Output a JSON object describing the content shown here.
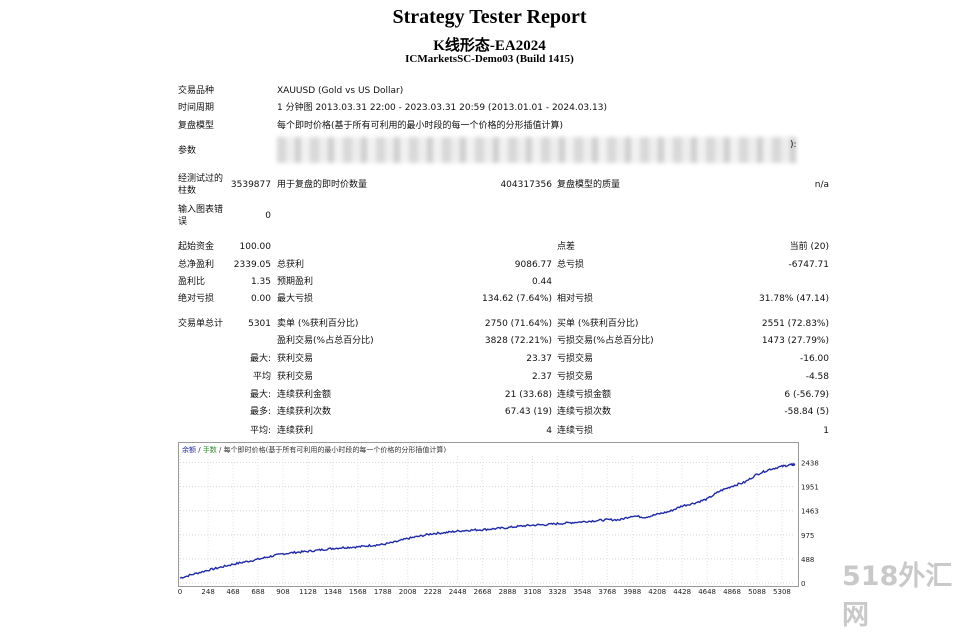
{
  "report": {
    "title": "Strategy Tester Report",
    "ea_name": "K线形态-EA2024",
    "server": "ICMarketsSC-Demo03 (Build 1415)"
  },
  "settings": {
    "symbol_label": "交易品种",
    "symbol_value": "XAUUSD (Gold vs US Dollar)",
    "period_label": "时间周期",
    "period_value": "1 分钟图 2013.03.31 22:00 - 2023.03.31 20:59 (2013.01.01 - 2024.03.13)",
    "model_label": "复盘模型",
    "model_value": "每个即时价格(基于所有可利用的最小时段的每一个价格的分形插值计算)",
    "params_label": "参数",
    "params_tail": "):"
  },
  "quality": {
    "bars_label": "经测试过的柱数",
    "bars_value": "3539877",
    "ticks_label": "用于复盘的即时价数量",
    "ticks_value": "404317356",
    "quality_label": "复盘模型的质量",
    "quality_value": "n/a",
    "errors_label": "输入图表错误",
    "errors_value": "0"
  },
  "stats": {
    "deposit_label": "起始资金",
    "deposit_value": "100.00",
    "spread_label": "点差",
    "spread_value": "当前 (20)",
    "net_label": "总净盈利",
    "net_value": "2339.05",
    "gross_profit_label": "总获利",
    "gross_profit_value": "9086.77",
    "gross_loss_label": "总亏损",
    "gross_loss_value": "-6747.71",
    "pf_label": "盈利比",
    "pf_value": "1.35",
    "payoff_label": "预期盈利",
    "payoff_value": "0.44",
    "abs_dd_label": "绝对亏损",
    "abs_dd_value": "0.00",
    "max_dd_label": "最大亏损",
    "max_dd_value": "134.62 (7.64%)",
    "rel_dd_label": "相对亏损",
    "rel_dd_value": "31.78% (47.14)",
    "trades_label": "交易单总计",
    "trades_value": "5301",
    "short_label": "卖单 (%获利百分比)",
    "short_value": "2750 (71.64%)",
    "long_label": "买单 (%获利百分比)",
    "long_value": "2551 (72.83%)",
    "profit_trades_label": "盈利交易(%占总百分比)",
    "profit_trades_value": "3828 (72.21%)",
    "loss_trades_label": "亏损交易(%占总百分比)",
    "loss_trades_value": "1473 (27.79%)",
    "largest_prefix": "最大:",
    "largest_profit_label": "获利交易",
    "largest_profit_value": "23.37",
    "largest_loss_label": "亏损交易",
    "largest_loss_value": "-16.00",
    "average_prefix": "平均",
    "avg_profit_label": "获利交易",
    "avg_profit_value": "2.37",
    "avg_loss_label": "亏损交易",
    "avg_loss_value": "-4.58",
    "max_prefix": "最大:",
    "max_consec_wins_label": "连续获利金额",
    "max_consec_wins_value": "21 (33.68)",
    "max_consec_losses_label": "连续亏损金额",
    "max_consec_losses_value": "6 (-56.79)",
    "most_prefix": "最多:",
    "most_consec_profit_label": "连续获利次数",
    "most_consec_profit_value": "67.43 (19)",
    "most_consec_loss_label": "连续亏损次数",
    "most_consec_loss_value": "-58.84 (5)",
    "avg2_prefix": "平均:",
    "avg_consec_wins_label": "连续获利",
    "avg_consec_wins_value": "4",
    "avg_consec_losses_label": "连续亏损",
    "avg_consec_losses_value": "1"
  },
  "chart_legend": {
    "balance": "余额",
    "sep": " / ",
    "volume": "手数",
    "desc": " / 每个即时价格(基于所有可利用的最小时段的每一个价格的分形插值计算)"
  },
  "watermark": "518外汇网",
  "chart_data": {
    "type": "line",
    "title": "",
    "xlabel": "",
    "ylabel": "",
    "x_ticks": [
      "0",
      "248",
      "468",
      "688",
      "908",
      "1128",
      "1348",
      "1568",
      "1788",
      "2008",
      "2228",
      "2448",
      "2668",
      "2888",
      "3108",
      "3328",
      "3548",
      "3768",
      "3988",
      "4208",
      "4428",
      "4648",
      "4868",
      "5088",
      "5308"
    ],
    "y_ticks": [
      "0",
      "488",
      "975",
      "1463",
      "1951",
      "2438"
    ],
    "xlim": [
      0,
      5423
    ],
    "ylim": [
      0,
      2570
    ],
    "colors": {
      "balance": "#1f2aa8"
    },
    "series": [
      {
        "x": [
          0,
          120,
          248,
          360,
          468,
          580,
          688,
          800,
          908,
          1020,
          1128,
          1240,
          1348,
          1460,
          1568,
          1680,
          1788,
          1900,
          2008,
          2120,
          2228,
          2340,
          2448,
          2560,
          2668,
          2780,
          2888,
          3000,
          3108,
          3220,
          3328,
          3440,
          3548,
          3660,
          3768,
          3880,
          3988,
          4100,
          4208,
          4320,
          4428,
          4540,
          4648,
          4760,
          4868,
          4980,
          5088,
          5200,
          5308,
          5380,
          5423
        ],
        "values": [
          100,
          180,
          260,
          320,
          380,
          430,
          480,
          540,
          590,
          620,
          640,
          670,
          700,
          720,
          730,
          760,
          780,
          830,
          900,
          950,
          1000,
          1020,
          1050,
          1070,
          1080,
          1100,
          1120,
          1150,
          1170,
          1180,
          1200,
          1220,
          1240,
          1260,
          1280,
          1280,
          1360,
          1330,
          1390,
          1450,
          1560,
          1620,
          1700,
          1860,
          1960,
          2040,
          2200,
          2300,
          2360,
          2390,
          2400
        ]
      }
    ]
  }
}
